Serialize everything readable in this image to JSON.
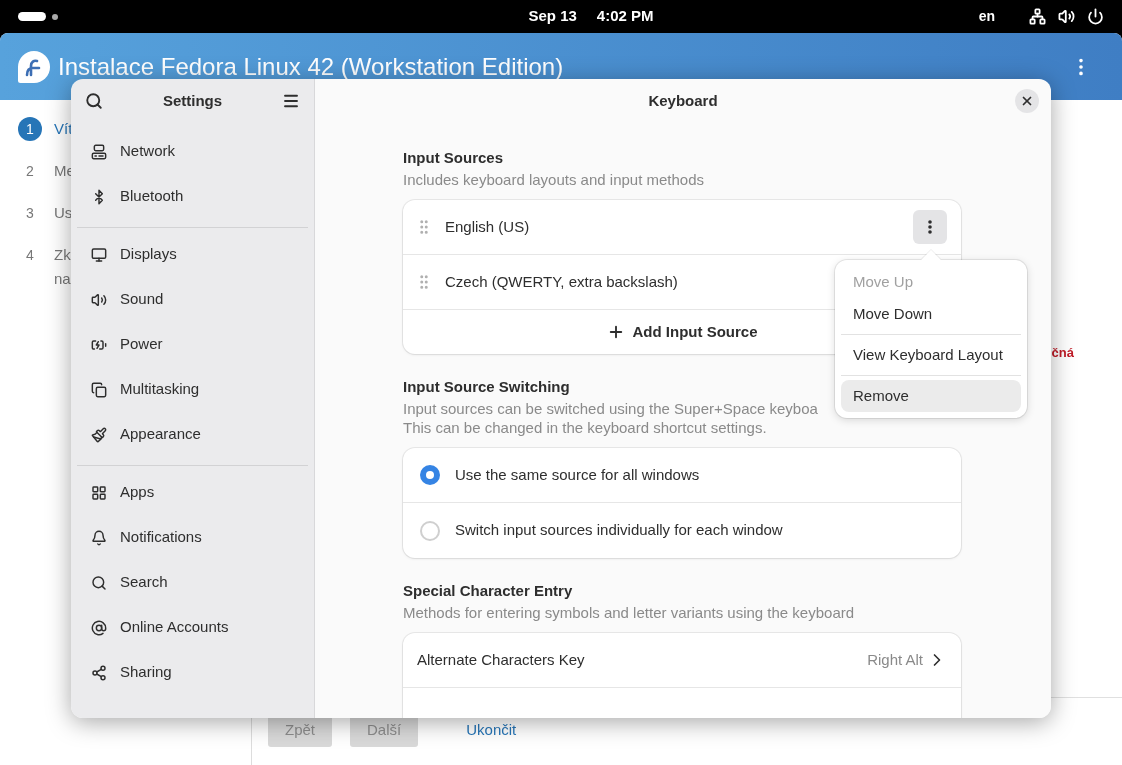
{
  "top_bar": {
    "date": "Sep 13",
    "time": "4:02 PM",
    "language": "en"
  },
  "installer": {
    "title": "Instalace Fedora Linux 42 (Workstation Edition)",
    "steps": [
      {
        "number": "1",
        "lines": [
          "Vít"
        ],
        "selected": true
      },
      {
        "number": "2",
        "lines": [
          "Me"
        ],
        "selected": false
      },
      {
        "number": "3",
        "lines": [
          "Us"
        ],
        "selected": false
      },
      {
        "number": "4",
        "lines": [
          "Zk",
          "na"
        ],
        "selected": false
      }
    ],
    "notice": "čná",
    "buttons": [
      {
        "kind": "button",
        "label": "Zpět",
        "disabled": true
      },
      {
        "kind": "button",
        "label": "Další",
        "disabled": true
      },
      {
        "kind": "link",
        "label": "Ukončit"
      }
    ]
  },
  "settings": {
    "sidebar_title": "Settings",
    "sidebar_groups": [
      [
        {
          "label": "Network"
        },
        {
          "label": "Bluetooth"
        }
      ],
      [
        {
          "label": "Displays"
        },
        {
          "label": "Sound"
        },
        {
          "label": "Power"
        },
        {
          "label": "Multitasking"
        },
        {
          "label": "Appearance"
        }
      ],
      [
        {
          "label": "Apps"
        },
        {
          "label": "Notifications"
        },
        {
          "label": "Search"
        },
        {
          "label": "Online Accounts"
        },
        {
          "label": "Sharing"
        }
      ]
    ],
    "panel_title": "Keyboard",
    "sections": [
      {
        "heading": "Input Sources",
        "description": [
          "Includes keyboard layouts and input methods"
        ],
        "rows": [
          {
            "kind": "source",
            "label": "English (US)",
            "menu_open": true
          },
          {
            "kind": "source",
            "label": "Czech (QWERTY, extra backslash)"
          },
          {
            "kind": "add",
            "label": "Add Input Source"
          }
        ]
      },
      {
        "heading": "Input Source Switching",
        "description": [
          "Input sources can be switched using the Super+Space keyboa",
          "This can be changed in the keyboard shortcut settings."
        ],
        "rows": [
          {
            "kind": "radio",
            "label": "Use the same source for all windows",
            "selected": true
          },
          {
            "kind": "radio",
            "label": "Switch input sources individually for each window",
            "selected": false
          }
        ]
      },
      {
        "heading": "Special Character Entry",
        "description": [
          "Methods for entering symbols and letter variants using the keyboard"
        ],
        "rows": [
          {
            "kind": "value",
            "label": "Alternate Characters Key",
            "value": "Right Alt"
          },
          {
            "kind": "cut_off"
          }
        ]
      }
    ]
  },
  "popover": {
    "groups": [
      [
        {
          "label": "Move Up",
          "disabled": true,
          "selected": false
        },
        {
          "label": "Move Down",
          "disabled": false,
          "selected": false
        }
      ],
      [
        {
          "label": "View Keyboard Layout",
          "disabled": false,
          "selected": false
        }
      ],
      [
        {
          "label": "Remove",
          "disabled": false,
          "selected": true
        }
      ]
    ]
  }
}
